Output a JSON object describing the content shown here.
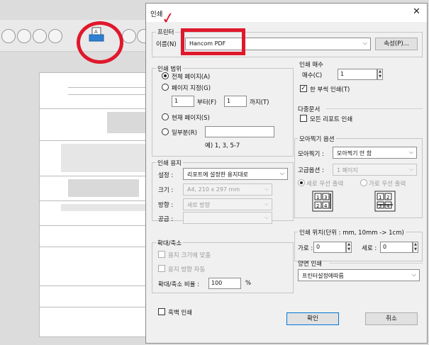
{
  "dialog": {
    "title": "인쇄",
    "printer": {
      "group_label": "프린터",
      "name_label": "이름(N)",
      "name_value": "Hancom PDF",
      "properties_button": "속성(P)..."
    },
    "print_range": {
      "group_label": "인쇄 범위",
      "all_pages": "전체 페이지(A)",
      "page_range": "페이지 지정(G)",
      "from_value": "1",
      "from_label": "부터(F)",
      "to_value": "1",
      "to_label": "까지(T)",
      "current_page": "현재 페이지(S)",
      "partial": "일부분(R)",
      "partial_value": "",
      "example": "예) 1, 3, 5-7"
    },
    "paper": {
      "group_label": "인쇄 용지",
      "setting_label": "설정 :",
      "setting_value": "리포트에 설정한 용지대로",
      "size_label": "크기 :",
      "size_value": "A4, 210 x 297 mm",
      "orientation_label": "방향 :",
      "orientation_value": "세로 방향",
      "source_label": "공급 :",
      "source_value": ""
    },
    "scale": {
      "group_label": "확대/축소",
      "fit_paper": "용지 크기에 맞춤",
      "auto_orient": "용지 방향 자동",
      "ratio_label": "확대/축소 비율 :",
      "ratio_value": "100",
      "ratio_unit": "%"
    },
    "grayscale": "흑백 인쇄",
    "copies": {
      "group_label": "인쇄 매수",
      "copies_label": "매수(C)",
      "copies_value": "1",
      "collate": "한 부씩 인쇄(T)"
    },
    "multi_doc": {
      "group_label": "다중문서",
      "all_reports": "모든 리포트 인쇄"
    },
    "nup": {
      "group_label": "모아찍기 옵션",
      "nup_label": "모아찍기 :",
      "nup_value": "모아찍기 안 함",
      "advanced_label": "고급옵션 :",
      "advanced_value": "1 페이지",
      "portrait_first": "세로 우선 출력",
      "landscape_first": "가로 우선 출력",
      "grid_nums": [
        "1",
        "3",
        "2",
        "4"
      ],
      "grid_nums2": [
        "1",
        "2",
        "3",
        "4"
      ]
    },
    "position": {
      "group_label": "인쇄 위치(단위 : mm, 10mm -> 1cm)",
      "h_label": "가로 :",
      "h_value": "0",
      "v_label": "세로 :",
      "v_value": "0"
    },
    "duplex": {
      "group_label": "양면 인쇄",
      "value": "프린터설정에따름"
    },
    "ok_button": "확인",
    "cancel_button": "취소"
  },
  "colors": {
    "annotation_red": "#e0182c",
    "accent": "#0078d7"
  }
}
